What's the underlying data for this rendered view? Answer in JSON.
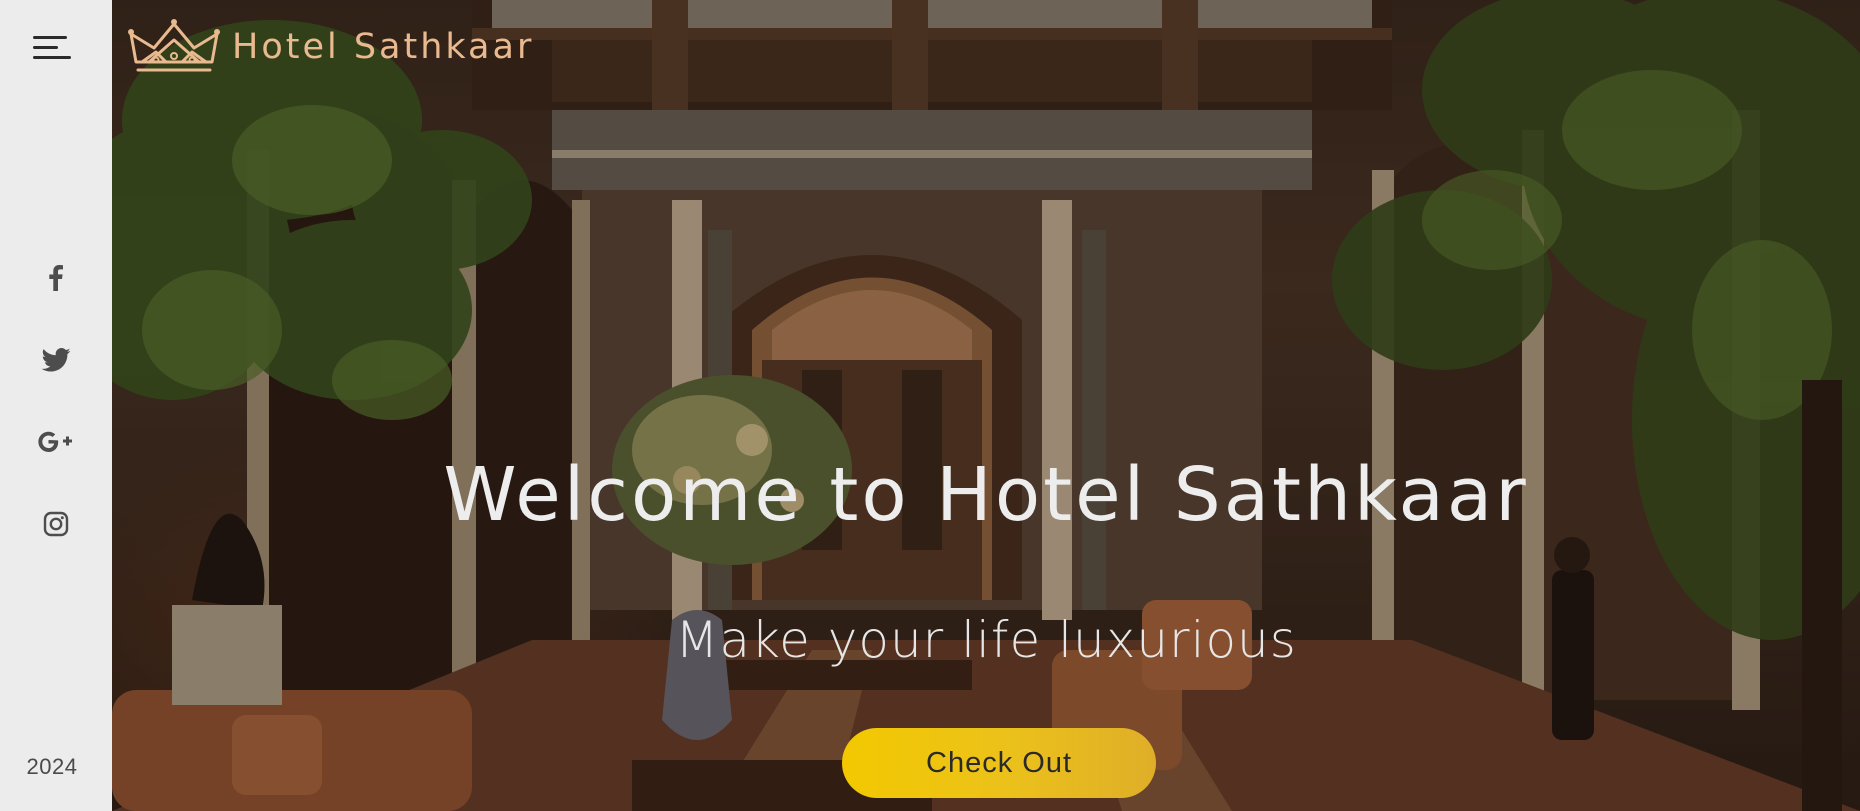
{
  "brand": {
    "name": "Hotel Sathkaar",
    "logo_icon": "crown-icon",
    "color": "#e9b98f"
  },
  "sidebar": {
    "menu_icon": "hamburger-menu-icon",
    "social": [
      {
        "name": "facebook",
        "icon": "facebook-icon"
      },
      {
        "name": "twitter",
        "icon": "twitter-icon"
      },
      {
        "name": "google-plus",
        "icon": "google-plus-icon"
      },
      {
        "name": "instagram",
        "icon": "instagram-icon"
      }
    ],
    "year": "2024",
    "background": "#ececec"
  },
  "hero": {
    "title": "Welcome to Hotel Sathkaar",
    "subtitle": "Make your life luxurious",
    "cta_label": "Check Out",
    "cta_color": "#f3c800"
  }
}
